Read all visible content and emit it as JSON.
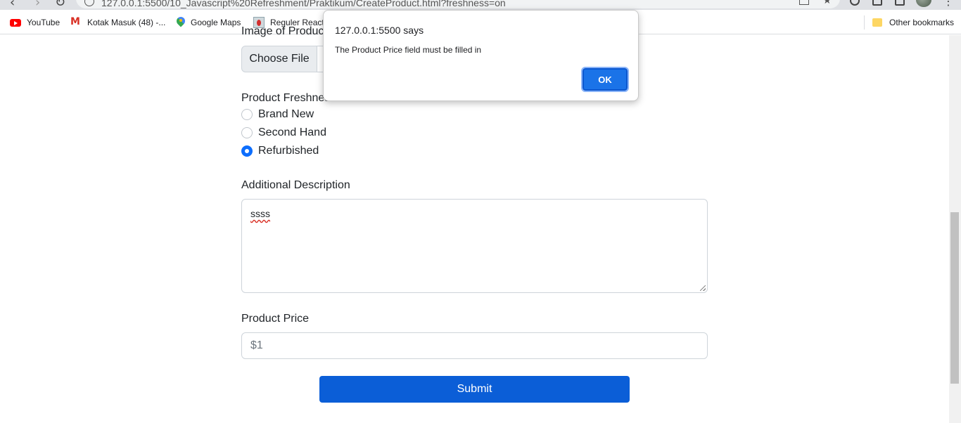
{
  "browser": {
    "url": "127.0.0.1:5500/10_Javascript%20Refreshment/Praktikum/CreateProduct.html?freshness=on",
    "bookmarks": [
      {
        "label": "YouTube",
        "icon": "youtube-icon"
      },
      {
        "label": "Kotak Masuk (48) -...",
        "icon": "gmail-icon"
      },
      {
        "label": "Google Maps",
        "icon": "google-maps-icon"
      },
      {
        "label": "Reguler React",
        "icon": "react-bookmark-icon"
      }
    ],
    "other_bookmarks": "Other bookmarks"
  },
  "form": {
    "image_label": "Image of Product",
    "choose_file": "Choose File",
    "freshness_label": "Product Freshness",
    "freshness_options": [
      {
        "label": "Brand New",
        "checked": false
      },
      {
        "label": "Second Hand",
        "checked": false
      },
      {
        "label": "Refurbished",
        "checked": true
      }
    ],
    "description_label": "Additional Description",
    "description_value": "ssss",
    "price_label": "Product Price",
    "price_placeholder": "$1",
    "submit_label": "Submit"
  },
  "alert": {
    "title": "127.0.0.1:5500 says",
    "message": "The Product Price field must be filled in",
    "ok_label": "OK"
  },
  "colors": {
    "accent": "#0b5ed7",
    "radio_checked": "#0d6efd",
    "dialog_ok": "#1a73e8"
  }
}
